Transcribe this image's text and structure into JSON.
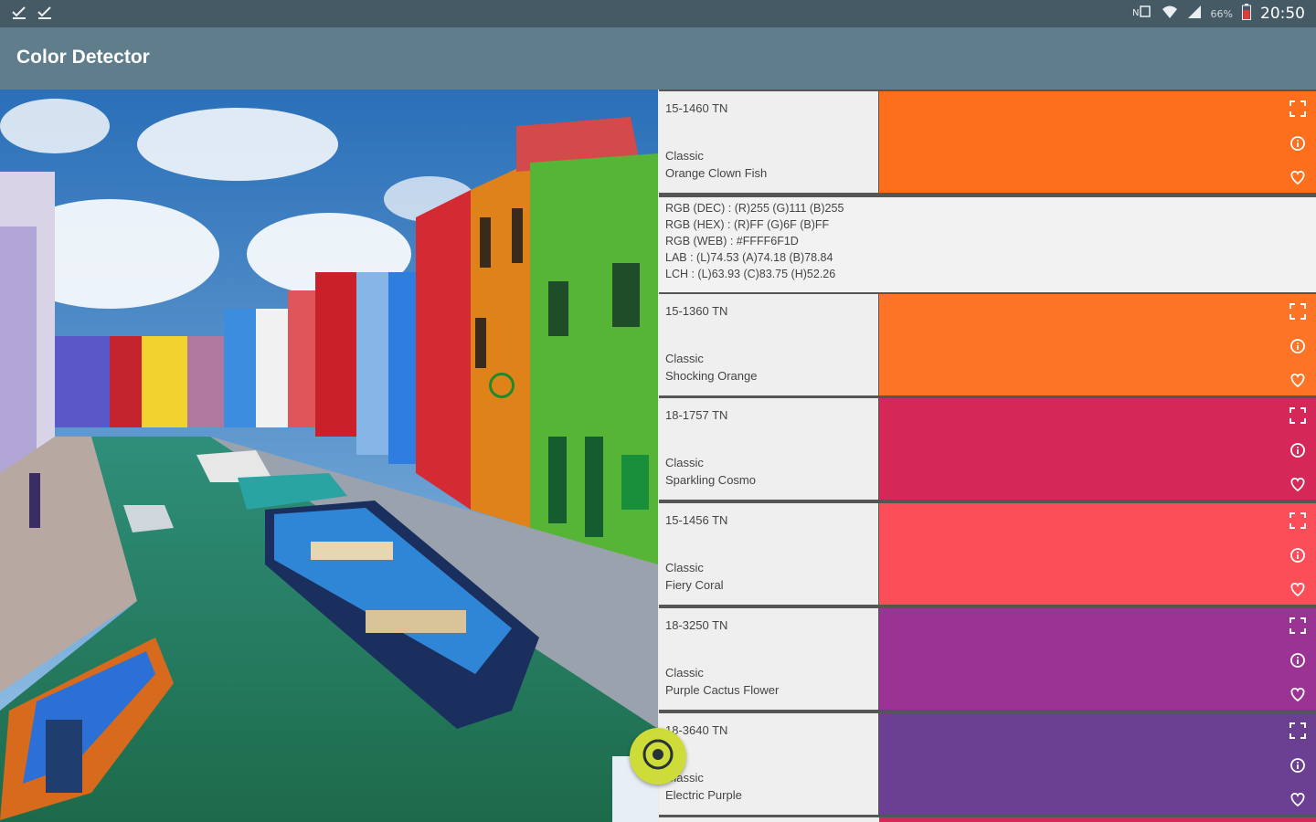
{
  "status_bar": {
    "time": "20:50",
    "battery_pct": "66%",
    "left_icons": [
      "download-done-icon",
      "download-done-icon"
    ],
    "right_icons": [
      "nfc-icon",
      "wifi-icon",
      "signal-icon",
      "battery-icon"
    ]
  },
  "app_bar": {
    "title": "Color Detector",
    "color": "#607d8b"
  },
  "image": {
    "description_icon": "photo-canal-houses",
    "marker_color": "#1f8a2a"
  },
  "fab": {
    "icon": "target-icon",
    "color": "#cddc39"
  },
  "colors": [
    {
      "code": "15-1460 TN",
      "book": "Classic",
      "name": "Orange Clown Fish",
      "hex": "#fe6f1d",
      "details": {
        "rgb_dec": "RGB (DEC) : (R)255  (G)111  (B)255",
        "rgb_hex": "RGB (HEX) : (R)FF  (G)6F  (B)FF",
        "rgb_web": "RGB (WEB) : #FFFF6F1D",
        "lab": "LAB : (L)74.53  (A)74.18  (B)78.84",
        "lch": "LCH : (L)63.93  (C)83.75  (H)52.26"
      }
    },
    {
      "code": "15-1360 TN",
      "book": "Classic",
      "name": "Shocking Orange",
      "hex": "#fe7426"
    },
    {
      "code": "18-1757 TN",
      "book": "Classic",
      "name": "Sparkling Cosmo",
      "hex": "#d62858"
    },
    {
      "code": "15-1456 TN",
      "book": "Classic",
      "name": "Fiery Coral",
      "hex": "#fc4e58"
    },
    {
      "code": "18-3250 TN",
      "book": "Classic",
      "name": "Purple Cactus Flower",
      "hex": "#9b3394"
    },
    {
      "code": "18-3640 TN",
      "book": "Classic",
      "name": "Electric Purple",
      "hex": "#6b3f91"
    }
  ]
}
